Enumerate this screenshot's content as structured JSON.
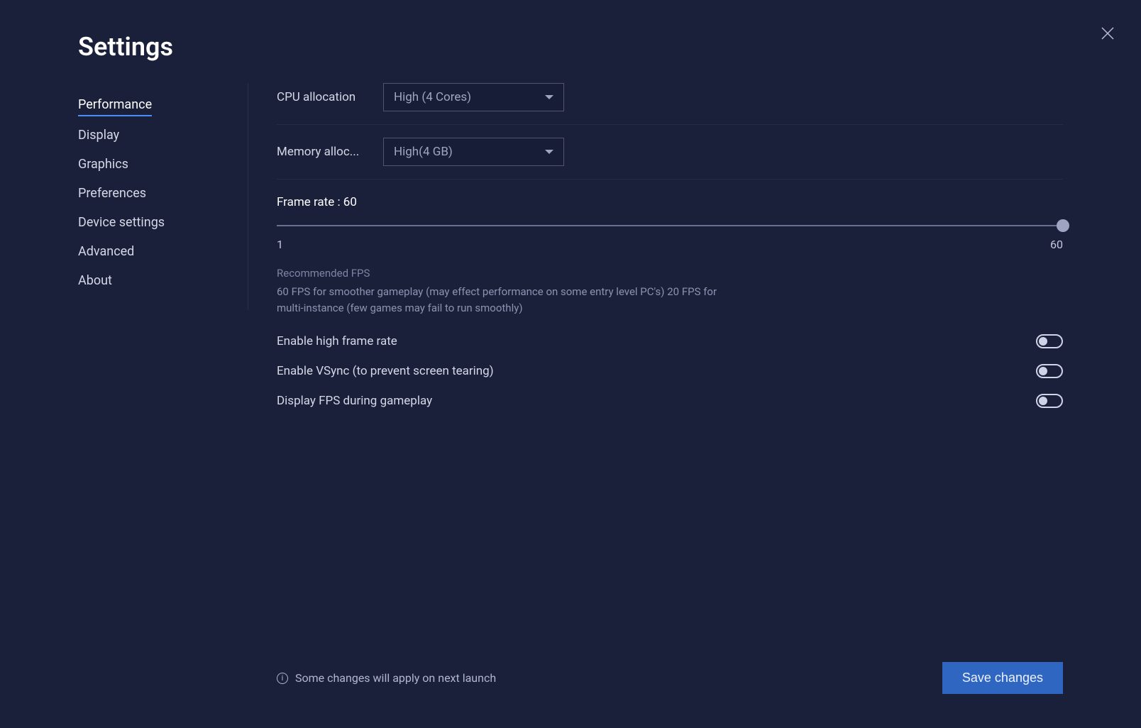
{
  "title": "Settings",
  "sidebar": {
    "items": [
      {
        "label": "Performance",
        "active": true
      },
      {
        "label": "Display"
      },
      {
        "label": "Graphics"
      },
      {
        "label": "Preferences"
      },
      {
        "label": "Device settings"
      },
      {
        "label": "Advanced"
      },
      {
        "label": "About"
      }
    ]
  },
  "main": {
    "cpu": {
      "label": "CPU allocation",
      "value": "High (4 Cores)"
    },
    "memory": {
      "label": "Memory alloc...",
      "value": "High(4 GB)"
    },
    "framerate": {
      "label": "Frame rate : 60",
      "min": "1",
      "max": "60",
      "note_title": "Recommended FPS",
      "note_body": "60 FPS for smoother gameplay (may effect performance on some entry level PC's) 20 FPS for multi-instance (few games may fail to run smoothly)"
    },
    "toggles": {
      "high_frame": "Enable high frame rate",
      "vsync": "Enable VSync (to prevent screen tearing)",
      "display_fps": "Display FPS during gameplay"
    }
  },
  "footer": {
    "note": "Some changes will apply on next launch",
    "save": "Save changes"
  }
}
